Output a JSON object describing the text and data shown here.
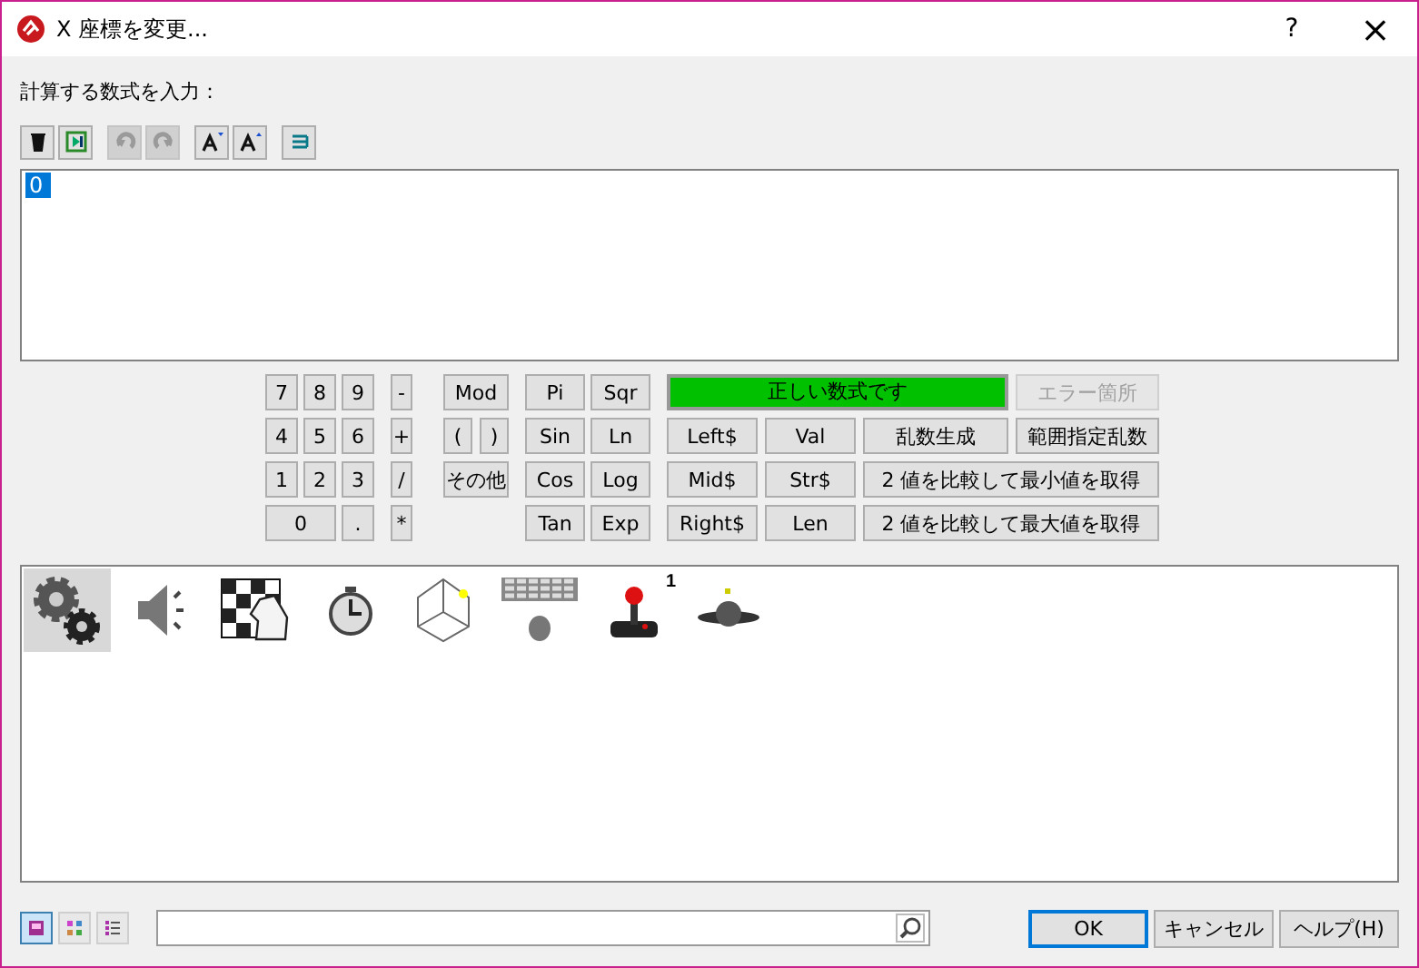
{
  "window": {
    "title": "X 座標を変更...",
    "help": "?",
    "close": "×"
  },
  "prompt": "計算する数式を入力：",
  "toolbar": [
    {
      "kind": "delete",
      "disabled": false
    },
    {
      "kind": "insert",
      "disabled": false
    },
    {
      "kind": "undo",
      "disabled": true
    },
    {
      "kind": "redo",
      "disabled": true
    },
    {
      "kind": "font-down",
      "disabled": false
    },
    {
      "kind": "font-up",
      "disabled": false
    },
    {
      "kind": "wrap",
      "disabled": false
    }
  ],
  "expression": {
    "value": "0",
    "selected": true
  },
  "calculator": {
    "digits": [
      "7",
      "8",
      "9",
      "-",
      "4",
      "5",
      "6",
      "+",
      "1",
      "2",
      "3",
      "/",
      "0",
      ".",
      "*"
    ],
    "operators": [
      "Mod",
      "(",
      ")",
      "その他"
    ],
    "functions": [
      "Pi",
      "Sqr",
      "Sin",
      "Ln",
      "Cos",
      "Log",
      "Tan",
      "Exp"
    ],
    "status": {
      "text": "正しい数式です",
      "valid": true
    },
    "error_button": {
      "label": "エラー箇所",
      "disabled": true
    },
    "string_functions": [
      "Left$",
      "Val",
      "乱数生成",
      "範囲指定乱数",
      "Mid$",
      "Str$",
      "2 値を比較して最小値を取得",
      "Right$",
      "Len",
      "2 値を比較して最大値を取得"
    ]
  },
  "categories": [
    {
      "kind": "gears",
      "selected": true
    },
    {
      "kind": "speaker",
      "selected": false
    },
    {
      "kind": "chess",
      "selected": false
    },
    {
      "kind": "stopwatch",
      "selected": false
    },
    {
      "kind": "cube",
      "selected": false
    },
    {
      "kind": "keyboard",
      "selected": false
    },
    {
      "kind": "joystick",
      "selected": false,
      "badge": "1"
    },
    {
      "kind": "planet",
      "selected": false
    }
  ],
  "view_buttons": [
    {
      "kind": "large",
      "selected": true
    },
    {
      "kind": "grid",
      "selected": false
    },
    {
      "kind": "list",
      "selected": false
    }
  ],
  "buttons": [
    {
      "label": "OK",
      "default": true
    },
    {
      "label": "キャンセル",
      "default": false
    },
    {
      "label": "ヘルプ(H)",
      "default": false
    }
  ]
}
